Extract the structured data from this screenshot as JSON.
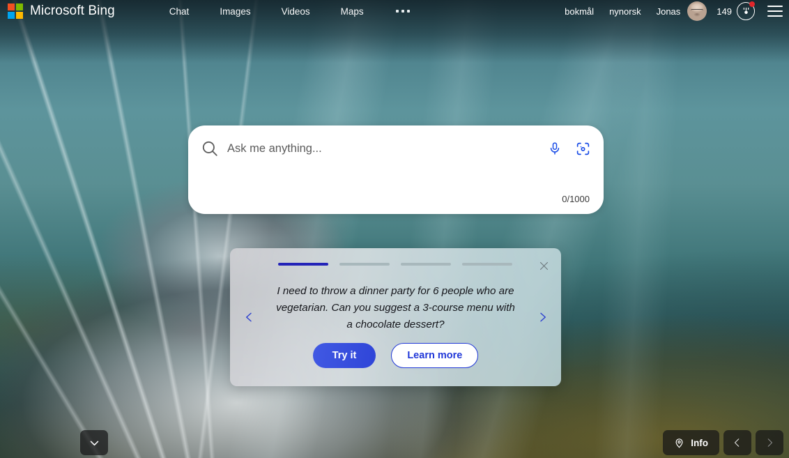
{
  "header": {
    "brand": "Microsoft Bing",
    "logo_colors": [
      "#f25022",
      "#7fba00",
      "#00a4ef",
      "#ffb900"
    ],
    "logo_icon": "microsoft-logo-icon",
    "nav": [
      {
        "label": "Chat",
        "name": "nav-item-chat"
      },
      {
        "label": "Images",
        "name": "nav-item-images"
      },
      {
        "label": "Videos",
        "name": "nav-item-videos"
      },
      {
        "label": "Maps",
        "name": "nav-item-maps"
      }
    ],
    "more_icon": "ellipsis-icon",
    "languages": [
      {
        "label": "bokmål",
        "name": "language-bokmal"
      },
      {
        "label": "nynorsk",
        "name": "language-nynorsk"
      }
    ],
    "user_name": "Jonas",
    "avatar_icon": "avatar",
    "rewards_count": "149",
    "rewards_icon": "rewards-medal-icon",
    "rewards_has_notification": true,
    "notification_color": "#e3262b",
    "menu_icon": "hamburger-menu-icon"
  },
  "search": {
    "placeholder": "Ask me anything...",
    "value": "",
    "counter": "0/1000",
    "search_icon": "search-icon",
    "mic_icon": "microphone-icon",
    "camera_icon": "visual-search-camera-icon",
    "accent_color": "#174ae6"
  },
  "promo": {
    "progress_total": 4,
    "progress_active_index": 0,
    "active_color": "#2323b8",
    "inactive_color": "#a8b8bc",
    "close_icon": "close-icon",
    "prev_icon": "chevron-left-icon",
    "next_icon": "chevron-right-icon",
    "prompt": "I need to throw a dinner party for 6 people who are vegetarian. Can you suggest a 3-course menu with a chocolate dessert?",
    "try_label": "Try it",
    "learn_label": "Learn more",
    "primary_color": "#2f45d8"
  },
  "bottom": {
    "scroll_icon": "chevron-down-icon",
    "info_label": "Info",
    "info_icon": "location-pin-icon",
    "prev_image_icon": "chevron-left-icon",
    "next_image_icon": "chevron-right-icon"
  }
}
